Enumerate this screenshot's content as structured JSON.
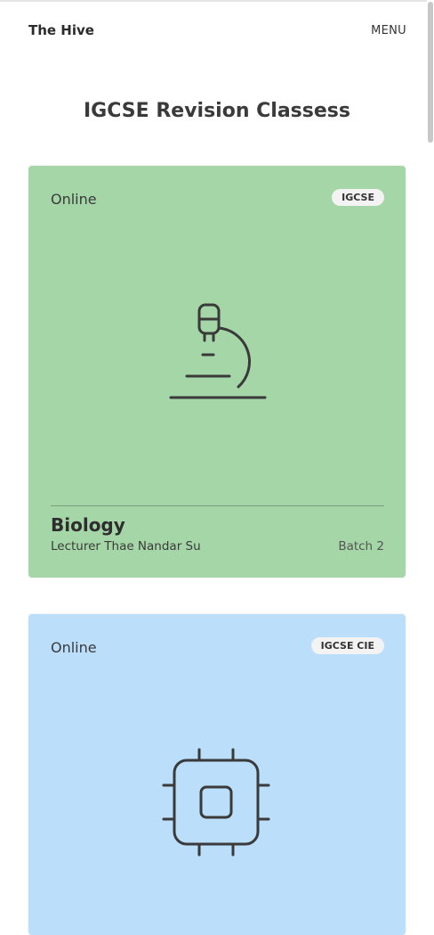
{
  "header": {
    "brand": "The Hive",
    "menu_label": "MENU"
  },
  "page": {
    "title": "IGCSE Revision Classess"
  },
  "cards": [
    {
      "mode": "Online",
      "badge": "IGCSE",
      "icon": "microscope-icon",
      "subject": "Biology",
      "lecturer": "Lecturer Thae Nandar Su",
      "batch": "Batch 2",
      "color": "#a5d6a7"
    },
    {
      "mode": "Online",
      "badge": "IGCSE CIE",
      "icon": "chip-icon",
      "color": "#bbdefb"
    }
  ]
}
